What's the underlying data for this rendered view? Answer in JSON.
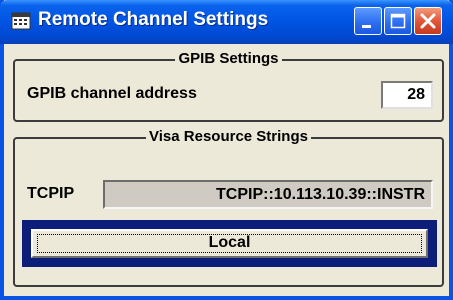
{
  "window": {
    "title": "Remote Channel Settings",
    "title_color": "#0054e3"
  },
  "titlebar_buttons": {
    "minimize_icon": "minimize-icon",
    "maximize_icon": "maximize-icon",
    "close_icon": "close-icon"
  },
  "gpib": {
    "group_title": "GPIB Settings",
    "address_label": "GPIB channel address",
    "address_value": "28"
  },
  "visa": {
    "group_title": "Visa Resource Strings",
    "tcpip_label": "TCPIP",
    "tcpip_value": "TCPIP::10.113.10.39::INSTR"
  },
  "local_button": {
    "label": "Local",
    "focus_color": "#0c1e7a"
  }
}
